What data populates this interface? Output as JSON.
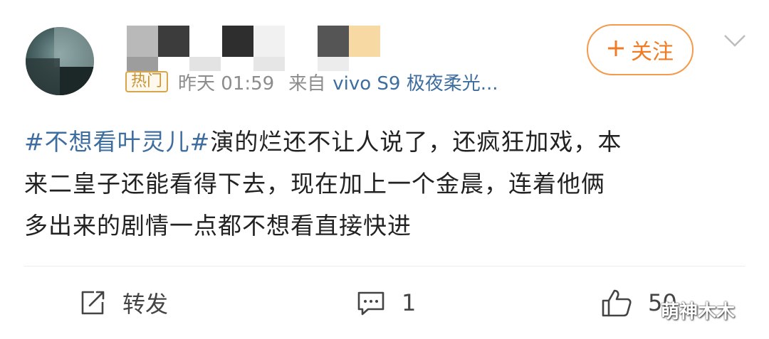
{
  "post": {
    "meta": {
      "badge": "热门",
      "time": "昨天 01:59",
      "source_prefix": "来自",
      "source_device": "vivo S9 极夜柔光..."
    },
    "follow_label": "关注",
    "hashtag": "#不想看叶灵儿#",
    "body_line1": "演的烂还不让人说了，还疯狂加戏，本",
    "body_line2": "来二皇子还能看得下去，现在加上一个金晨，连着他俩",
    "body_line3": "多出来的剧情一点都不想看直接快进"
  },
  "actions": {
    "repost_label": "转发",
    "comment_count": "1",
    "like_count": "50"
  },
  "watermark": "萌神木木",
  "icons": {
    "follow": "plus-icon",
    "more": "chevron-down-icon",
    "repost": "share-icon",
    "comment": "comment-icon",
    "like": "thumbs-up-icon"
  },
  "colors": {
    "link": "#3e6da0",
    "follow": "#f07b22",
    "hot_badge": "#d7a54b"
  }
}
